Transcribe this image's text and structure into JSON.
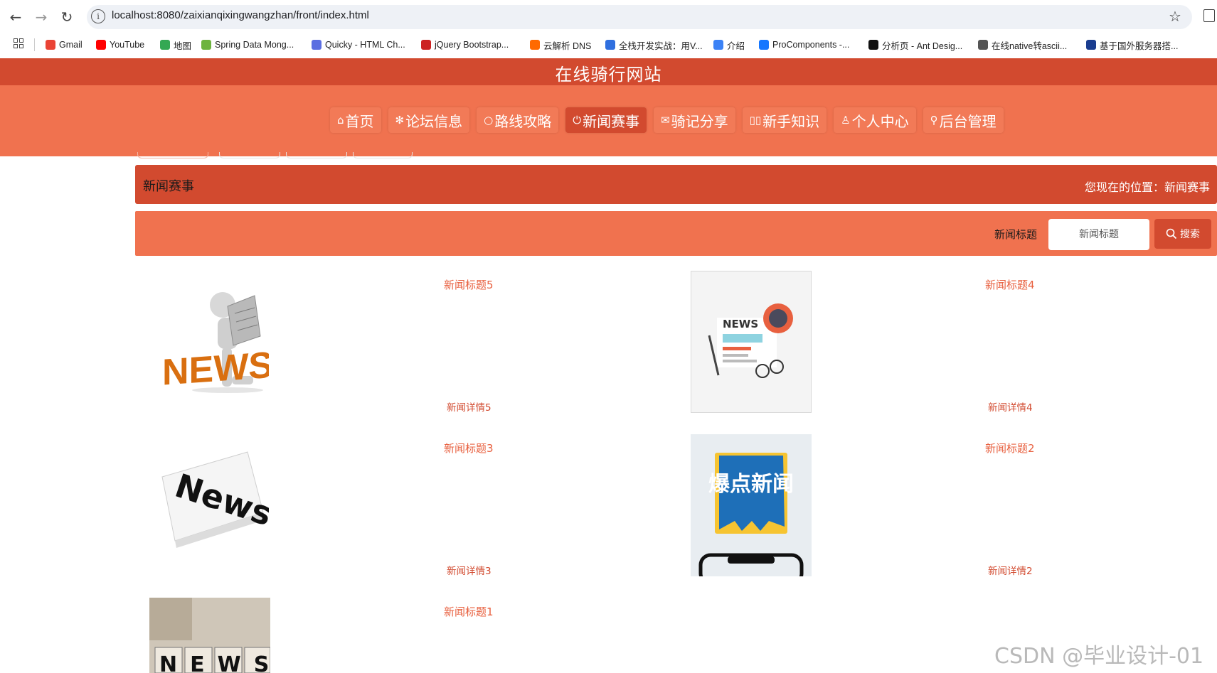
{
  "browser": {
    "url": "localhost:8080/zaixianqixingwangzhan/front/index.html",
    "bookmarks": [
      {
        "label": "Gmail",
        "icon": "gmail-icon",
        "color": "#ea4335"
      },
      {
        "label": "YouTube",
        "icon": "youtube-icon",
        "color": "#ff0000"
      },
      {
        "label": "地图",
        "icon": "maps-icon",
        "color": "#34a853"
      },
      {
        "label": "Spring Data Mong...",
        "icon": "spring-icon",
        "color": "#6db33f"
      },
      {
        "label": "Quicky - HTML Ch...",
        "icon": "quicky-icon",
        "color": "#5b6ee1"
      },
      {
        "label": "jQuery Bootstrap...",
        "icon": "jquery-icon",
        "color": "#cc2222"
      },
      {
        "label": "云解析 DNS",
        "icon": "aliyun-icon",
        "color": "#ff6a00"
      },
      {
        "label": "全栈开发实战：用V...",
        "icon": "m-icon",
        "color": "#2f6fdf"
      },
      {
        "label": "介绍",
        "icon": "globe-icon",
        "color": "#3b82f6"
      },
      {
        "label": "ProComponents -...",
        "icon": "antd-icon",
        "color": "#1677ff"
      },
      {
        "label": "分析页 - Ant Desig...",
        "icon": "pro-icon",
        "color": "#111111"
      },
      {
        "label": "在线native转ascii...",
        "icon": "world-icon",
        "color": "#555555"
      },
      {
        "label": "基于国外服务器搭...",
        "icon": "flag-icon",
        "color": "#1a3d8f"
      }
    ]
  },
  "site": {
    "title": "在线骑行网站",
    "nav": [
      {
        "icon": "⌂",
        "label": "首页",
        "active": false
      },
      {
        "icon": "✻",
        "label": "论坛信息",
        "active": false
      },
      {
        "icon": "○",
        "label": "路线攻略",
        "active": false
      },
      {
        "icon": "⏻",
        "label": "新闻赛事",
        "active": true
      },
      {
        "icon": "✉",
        "label": "骑记分享",
        "active": false
      },
      {
        "icon": "▯▯",
        "label": "新手知识",
        "active": false
      },
      {
        "icon": "♙",
        "label": "个人中心",
        "active": false
      },
      {
        "icon": "⚲",
        "label": "后台管理",
        "active": false
      }
    ]
  },
  "breadcrumb": {
    "title": "新闻赛事",
    "location": "您现在的位置：新闻赛事"
  },
  "search": {
    "label": "新闻标题",
    "placeholder": "新闻标题",
    "button": "搜索"
  },
  "news": [
    {
      "title": "新闻标题5",
      "detail": "新闻详情5",
      "image": "news-3d-figure-image"
    },
    {
      "title": "新闻标题4",
      "detail": "新闻详情4",
      "image": "news-flat-illustration-image"
    },
    {
      "title": "新闻标题3",
      "detail": "新闻详情3",
      "image": "newspaper-image"
    },
    {
      "title": "新闻标题2",
      "detail": "新闻详情2",
      "image": "breaking-news-image",
      "image_text": "爆点新闻"
    },
    {
      "title": "新闻标题1",
      "detail": "",
      "image": "news-cubes-image"
    }
  ],
  "watermark": "CSDN @毕业设计-01",
  "colors": {
    "primary": "#d24a2f",
    "secondary": "#f0724f",
    "link": "#e8603f"
  }
}
